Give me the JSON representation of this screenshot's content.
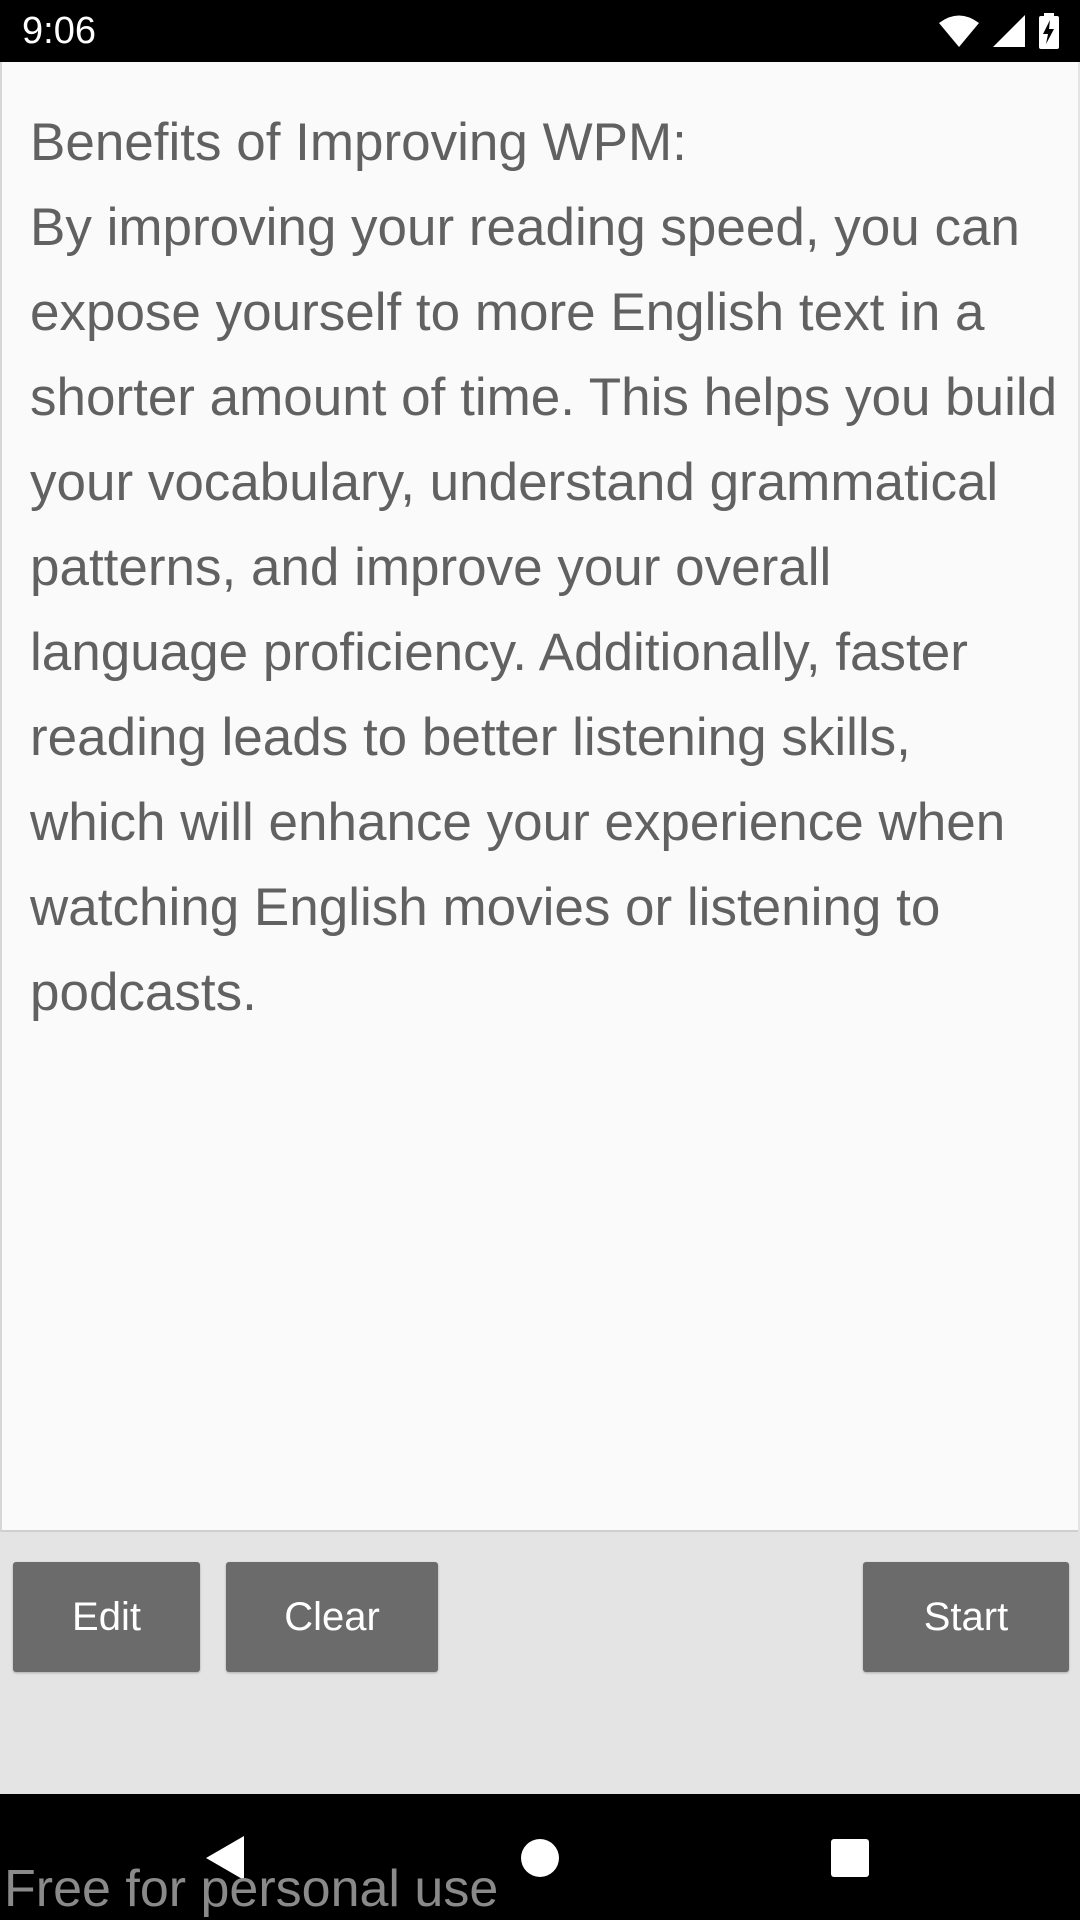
{
  "status_bar": {
    "time": "9:06",
    "icons": [
      "wifi-icon",
      "cell-signal-icon",
      "battery-charging-icon"
    ]
  },
  "reading_panel": {
    "text": "Benefits of Improving WPM:\nBy improving your reading speed, you can expose yourself to more English text in a shorter amount of time. This helps you build your vocabulary, understand grammatical patterns, and improve your overall language proficiency. Additionally, faster reading leads to better listening skills, which will enhance your experience when watching English movies or listening to podcasts."
  },
  "buttons": {
    "edit_label": "Edit",
    "clear_label": "Clear",
    "start_label": "Start"
  },
  "nav_bar": {
    "icons": [
      "back-icon",
      "home-icon",
      "recent-apps-icon"
    ]
  },
  "watermark": {
    "text": "Free for personal use"
  },
  "colors": {
    "status_bar": "#000000",
    "panel_background": "#fafafa",
    "text": "#616161",
    "button": "#6b6b6b",
    "button_text": "#ffffff",
    "background": "#e4e4e4"
  }
}
